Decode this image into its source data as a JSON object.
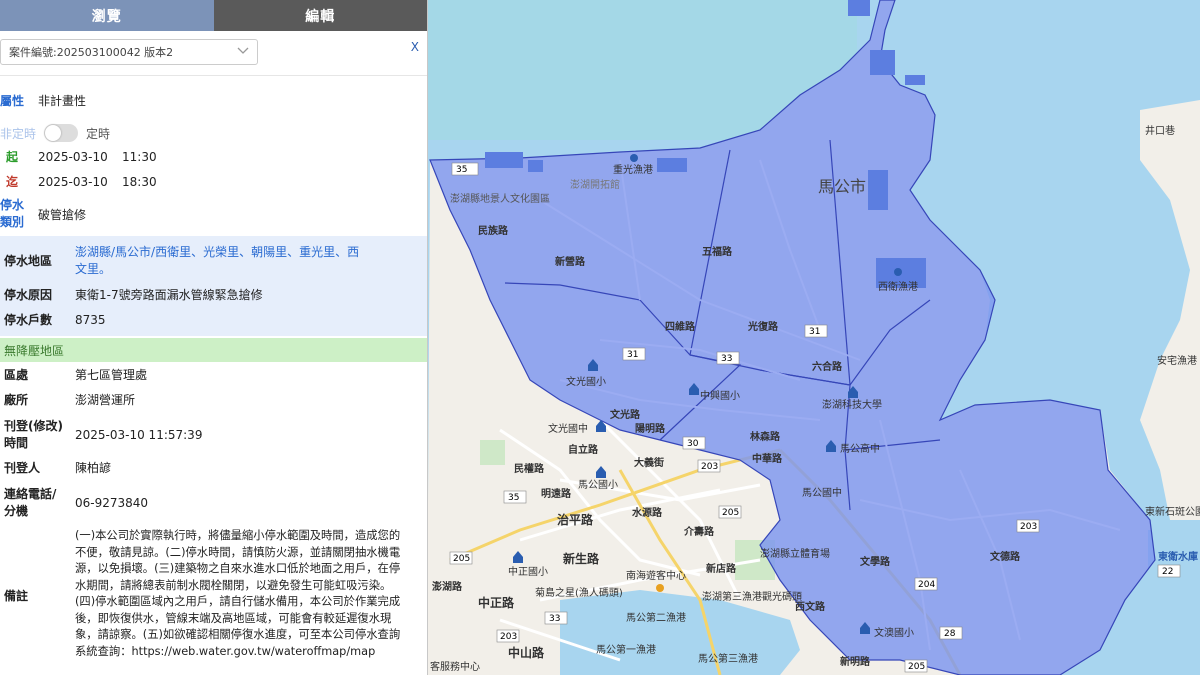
{
  "tabs": [
    {
      "label": "瀏覽",
      "active": true
    },
    {
      "label": "編輯",
      "active": false
    }
  ],
  "case_select": {
    "value": "案件編號:202503100042 版本2"
  },
  "close_label": "X",
  "attribute": {
    "label": "屬性",
    "value": "非計畫性"
  },
  "timing": {
    "left_label": "非定時",
    "right_label": "定時"
  },
  "start": {
    "label": "起",
    "date": "2025-03-10",
    "time": "11:30"
  },
  "end": {
    "label": "迄",
    "date": "2025-03-10",
    "time": "18:30"
  },
  "outage_type": {
    "label_line1": "停水",
    "label_line2": "類別",
    "value": "破管搶修"
  },
  "outage_area": {
    "label": "停水地區",
    "value_line1": "澎湖縣/馬公市/西衛里、光榮里、朝陽里、重光里、西",
    "value_line2": "文里。"
  },
  "outage_reason": {
    "label": "停水原因",
    "value": "東衛1-7號旁路面漏水管線緊急搶修"
  },
  "households": {
    "label": "停水戶數",
    "value": "8735"
  },
  "no_pressure_label": "無降壓地區",
  "district": {
    "label": "區處",
    "value": "第七區管理處"
  },
  "office": {
    "label": "廠所",
    "value": "澎湖營運所"
  },
  "published": {
    "label_line1": "刊登(修改)",
    "label_line2": "時間",
    "value": "2025-03-10 11:57:39"
  },
  "publisher": {
    "label": "刊登人",
    "value": "陳柏諺"
  },
  "phone": {
    "label_line1": "連絡電話/",
    "label_line2": "分機",
    "value": "06-9273840"
  },
  "notes": {
    "label": "備註",
    "lines": [
      "(一)本公司於實際執行時，將儘量縮小停水範圍及時間，造成您的",
      "不便，敬請見諒。(二)停水時間，請慎防火源，並請關閉抽水機電",
      "源，以免損壞。(三)建築物之自來水進水口低於地面之用戶，在停",
      "水期間，請將總表前制水閥栓關閉，以避免發生可能虹吸污染。",
      "(四)停水範圍區域內之用戶，請自行儲水備用，本公司於作業完成",
      "後，即恢復供水，管線末端及高地區域，可能會有較延遲復水現",
      "象，請諒察。(五)如欲確認相關停復水進度，可至本公司停水查詢",
      "系統查詢：https://web.water.gov.tw/wateroffmap/map"
    ]
  },
  "map": {
    "colors": {
      "sea": "#a8d5ef",
      "land": "#f2efe9",
      "overlay": "#7d96ef",
      "outline": "#3646b8"
    },
    "labels": [
      {
        "text": "馬公市",
        "kind": "city"
      },
      {
        "text": "澎湖開拓館",
        "kind": "place"
      },
      {
        "text": "重光漁港",
        "kind": "place"
      },
      {
        "text": "澎湖縣地景人文化園區",
        "kind": "place"
      },
      {
        "text": "西衛漁港",
        "kind": "place"
      },
      {
        "text": "井口巷",
        "kind": "place"
      },
      {
        "text": "安宅漁港",
        "kind": "place"
      },
      {
        "text": "東新石斑公園",
        "kind": "place"
      },
      {
        "text": "東衛水庫",
        "kind": "water"
      },
      {
        "text": "澎湖科技大學",
        "kind": "place"
      },
      {
        "text": "文光國小",
        "kind": "place"
      },
      {
        "text": "中興國小",
        "kind": "place"
      },
      {
        "text": "文光國中",
        "kind": "place"
      },
      {
        "text": "馬公高中",
        "kind": "place"
      },
      {
        "text": "馬公國小",
        "kind": "place"
      },
      {
        "text": "馬公國中",
        "kind": "place"
      },
      {
        "text": "中正國小",
        "kind": "place"
      },
      {
        "text": "澎湖縣立體育場",
        "kind": "place"
      },
      {
        "text": "南海遊客中心",
        "kind": "place"
      },
      {
        "text": "菊島之星(漁人碼頭)",
        "kind": "place"
      },
      {
        "text": "澎湖第三漁港觀光碼頭",
        "kind": "place"
      },
      {
        "text": "馬公第二漁港",
        "kind": "place"
      },
      {
        "text": "馬公第一漁港",
        "kind": "place"
      },
      {
        "text": "馬公第三漁港",
        "kind": "place"
      },
      {
        "text": "文澳國小",
        "kind": "place"
      },
      {
        "text": "客服務中心",
        "kind": "place"
      },
      {
        "text": "自立路",
        "kind": "road"
      },
      {
        "text": "明遠路",
        "kind": "road"
      },
      {
        "text": "治平路",
        "kind": "road"
      },
      {
        "text": "大義街",
        "kind": "road"
      },
      {
        "text": "水源路",
        "kind": "road"
      },
      {
        "text": "中山路",
        "kind": "road"
      },
      {
        "text": "中正路",
        "kind": "road"
      },
      {
        "text": "新生路",
        "kind": "road"
      },
      {
        "text": "民權路",
        "kind": "road"
      },
      {
        "text": "民族路",
        "kind": "road"
      },
      {
        "text": "文光路",
        "kind": "road"
      },
      {
        "text": "陽明路",
        "kind": "road"
      },
      {
        "text": "中華路",
        "kind": "road"
      },
      {
        "text": "光復路",
        "kind": "road"
      },
      {
        "text": "四維路",
        "kind": "road"
      },
      {
        "text": "六合路",
        "kind": "road"
      },
      {
        "text": "五福路",
        "kind": "road"
      },
      {
        "text": "林森路",
        "kind": "road"
      },
      {
        "text": "新店路",
        "kind": "road"
      },
      {
        "text": "文學路",
        "kind": "road"
      },
      {
        "text": "西文路",
        "kind": "road"
      },
      {
        "text": "新明路",
        "kind": "road"
      },
      {
        "text": "文德路",
        "kind": "road"
      },
      {
        "text": "介壽路",
        "kind": "road"
      },
      {
        "text": "新營路",
        "kind": "road"
      },
      {
        "text": "澎湖路",
        "kind": "road"
      }
    ],
    "route_shields": [
      "35",
      "31",
      "31",
      "33",
      "30",
      "35",
      "203",
      "205",
      "205",
      "204",
      "203",
      "33",
      "28",
      "22",
      "205",
      "203"
    ]
  }
}
